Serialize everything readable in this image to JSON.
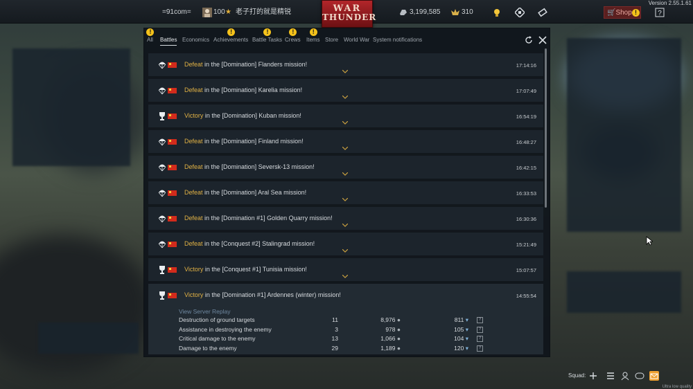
{
  "topbar": {
    "clan_tag": "=91com=",
    "player_level": "100",
    "player_name": "老子打的就是精锐",
    "logo_line1": "WAR",
    "logo_line2": "THUNDER",
    "silver_lions": "3,199,585",
    "golden_eagles": "310",
    "shop_label": "Shop",
    "version": "Version 2.55.1.61"
  },
  "tabs": [
    {
      "label": "All",
      "alert": true
    },
    {
      "label": "Battles",
      "active": true
    },
    {
      "label": "Economics",
      "alert": false
    },
    {
      "label": "Achievements",
      "alert": true
    },
    {
      "label": "Battle Tasks",
      "alert": true
    },
    {
      "label": "Crews",
      "alert": true
    },
    {
      "label": "Items",
      "alert": true
    },
    {
      "label": "Store"
    },
    {
      "label": "World War"
    },
    {
      "label": "System notifications"
    }
  ],
  "battles": [
    {
      "result": "Defeat",
      "text": " in the [Domination] Flanders mission!",
      "time": "17:14:16"
    },
    {
      "result": "Defeat",
      "text": " in the [Domination] Karelia mission!",
      "time": "17:07:49"
    },
    {
      "result": "Victory",
      "text": " in the [Domination] Kuban mission!",
      "time": "16:54:19"
    },
    {
      "result": "Defeat",
      "text": " in the [Domination] Finland mission!",
      "time": "16:48:27"
    },
    {
      "result": "Defeat",
      "text": " in the [Domination] Seversk-13 mission!",
      "time": "16:42:15"
    },
    {
      "result": "Defeat",
      "text": " in the [Domination] Aral Sea mission!",
      "time": "16:33:53"
    },
    {
      "result": "Defeat",
      "text": " in the [Domination #1] Golden Quarry mission!",
      "time": "16:30:36"
    },
    {
      "result": "Defeat",
      "text": " in the [Conquest #2] Stalingrad mission!",
      "time": "15:21:49"
    },
    {
      "result": "Victory",
      "text": " in the [Conquest #1] Tunisia mission!",
      "time": "15:07:57"
    },
    {
      "result": "Victory",
      "text": " in the [Domination #1] Ardennes (winter) mission!",
      "time": "14:55:54"
    }
  ],
  "expanded": {
    "replay_label": "View Server Replay",
    "rows": [
      {
        "name": "Destruction of ground targets",
        "count": "11",
        "silver": "8,976",
        "rp": "811"
      },
      {
        "name": "Assistance in destroying the enemy",
        "count": "3",
        "silver": "978",
        "rp": "105"
      },
      {
        "name": "Critical damage to the enemy",
        "count": "13",
        "silver": "1,066",
        "rp": "104"
      },
      {
        "name": "Damage to the enemy",
        "count": "29",
        "silver": "1,189",
        "rp": "120"
      }
    ],
    "help_glyph": "?"
  },
  "bottom": {
    "squad_label": "Squad:",
    "quality": "Ultra low quality"
  }
}
